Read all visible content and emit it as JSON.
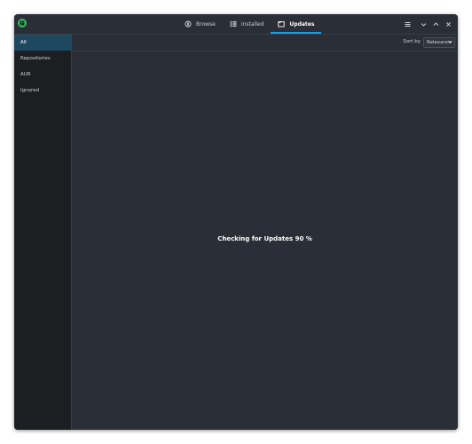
{
  "app": {
    "logo_icon": "manjaro-logo-icon"
  },
  "tabs": [
    {
      "label": "Browse",
      "icon": "browse-icon",
      "active": false
    },
    {
      "label": "Installed",
      "icon": "list-icon",
      "active": false
    },
    {
      "label": "Updates",
      "icon": "updates-icon",
      "active": true
    }
  ],
  "window_controls": {
    "menu_icon": "hamburger-menu-icon",
    "minimize_icon": "chevron-down-icon",
    "maximize_icon": "chevron-up-icon",
    "close_icon": "close-icon"
  },
  "sidebar": {
    "items": [
      {
        "label": "All",
        "active": true
      },
      {
        "label": "Repositories",
        "active": false
      },
      {
        "label": "AUR",
        "active": false
      },
      {
        "label": "Ignored",
        "active": false
      }
    ]
  },
  "toolbar": {
    "sort_label": "Sort by",
    "sort_value": "Relevance"
  },
  "main": {
    "status_text": "Checking for Updates 90 %"
  },
  "colors": {
    "accent": "#1f9ddc",
    "sidebar_active": "#1e4760",
    "background": "#2a2e36",
    "sidebar_bg": "#1c1e22"
  }
}
